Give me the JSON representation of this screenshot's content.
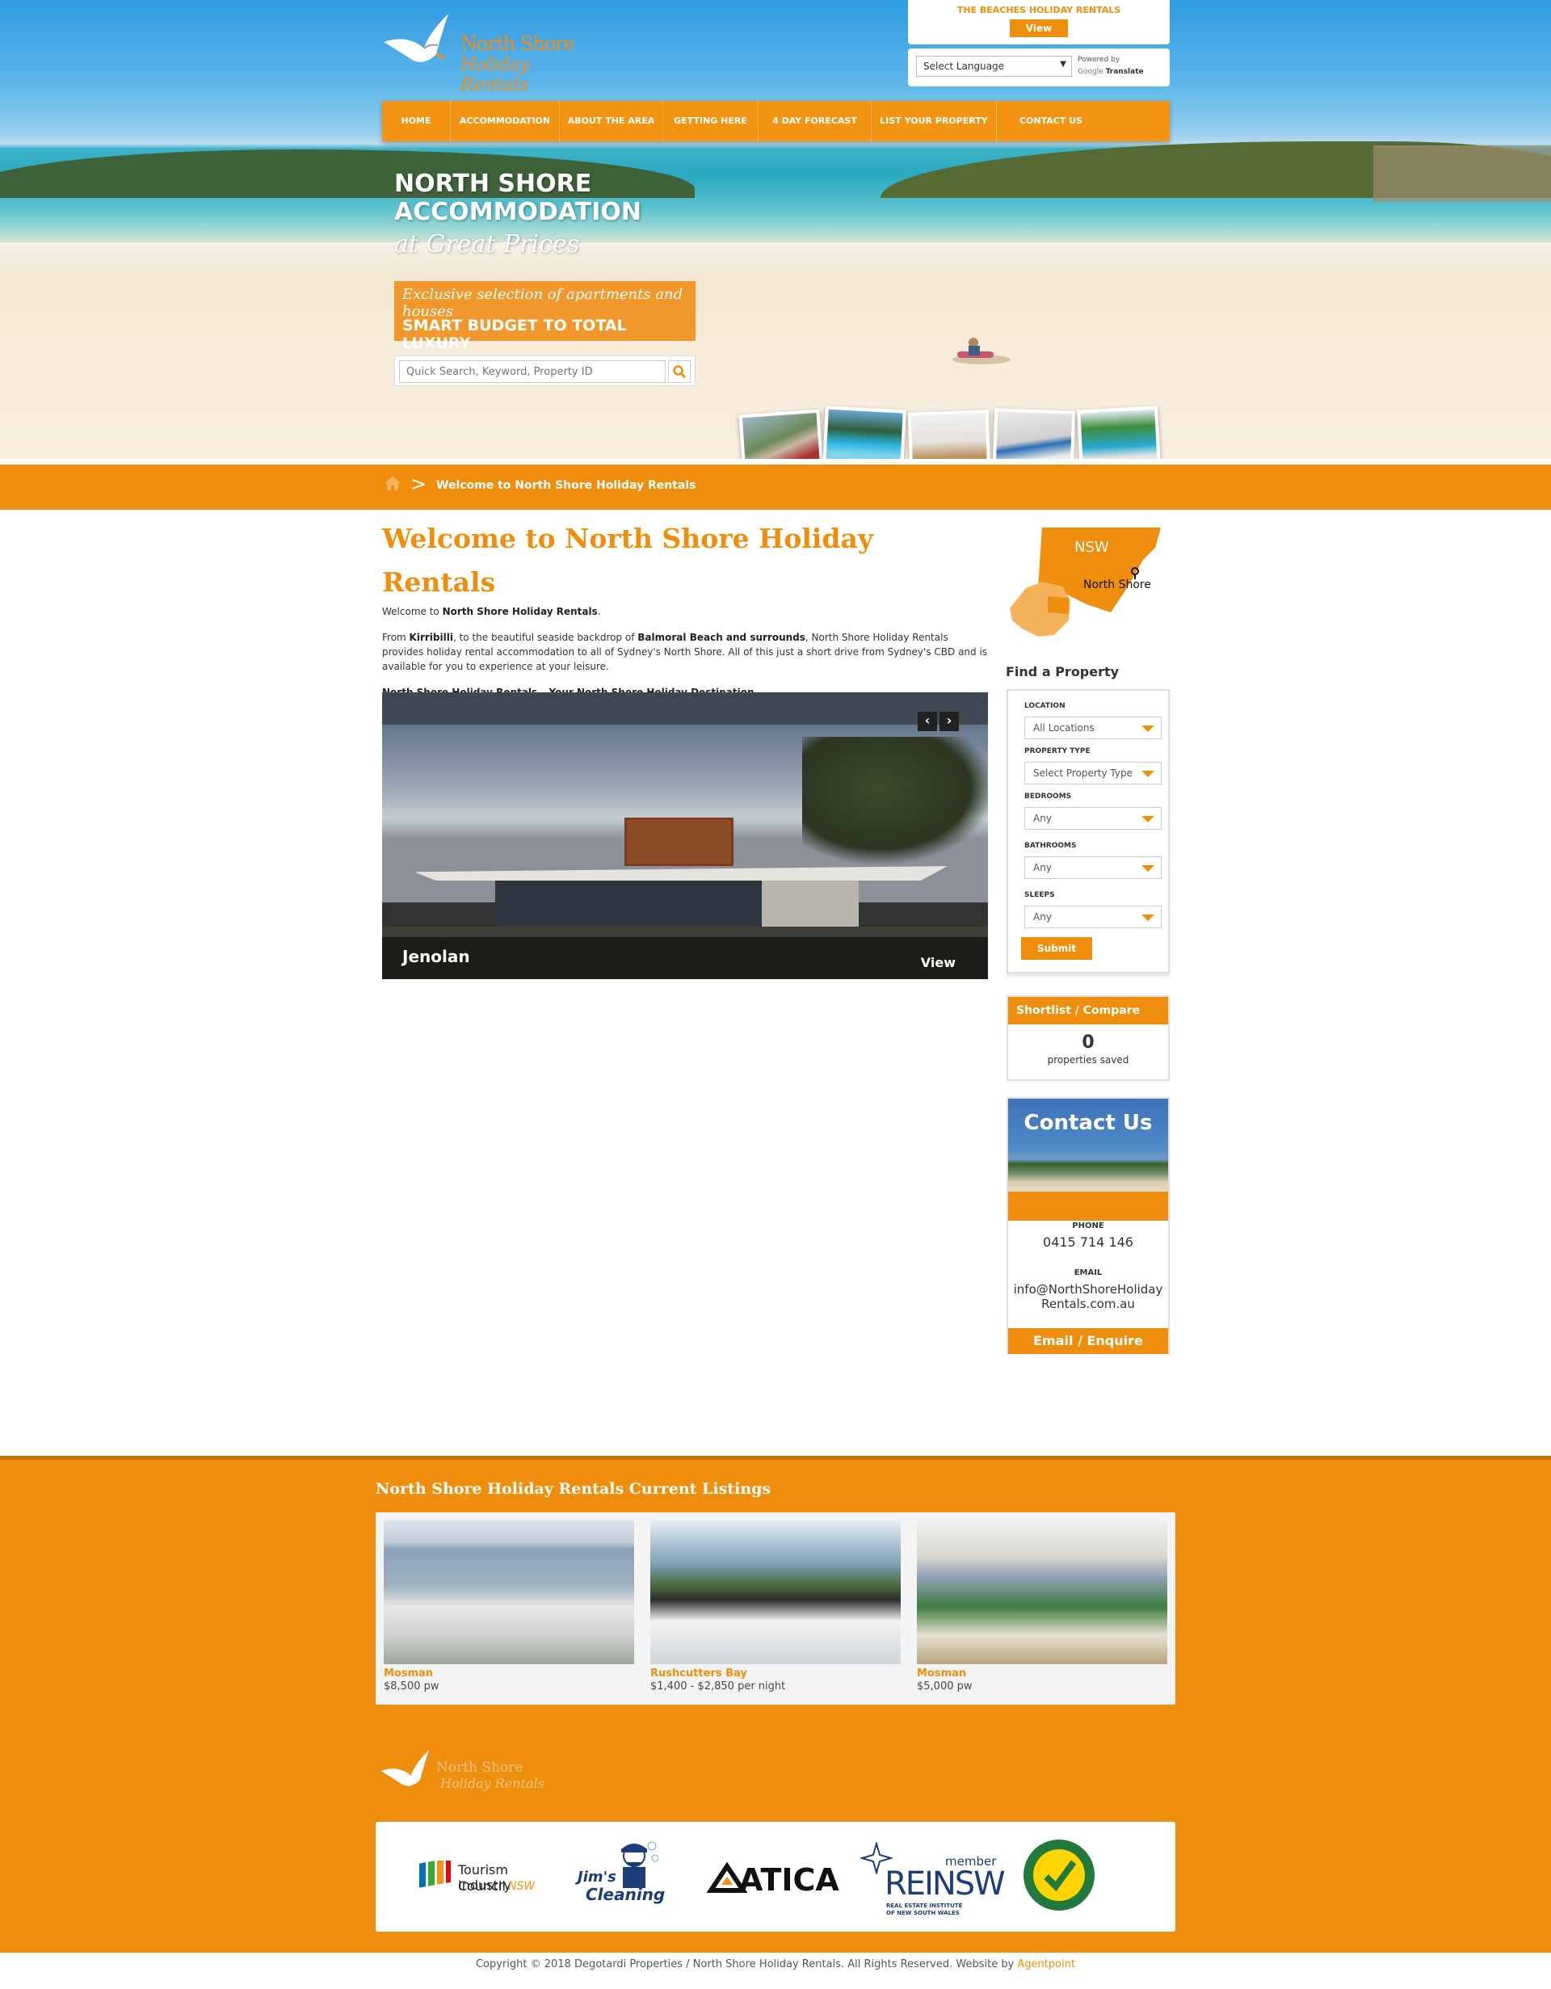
{
  "header": {
    "logo_line1": "North Shore",
    "logo_line2": "Holiday Rentals",
    "beaches_title": "THE BEACHES HOLIDAY RENTALS",
    "beaches_view": "View",
    "language_select": "Select Language",
    "powered_by": "Powered by",
    "google": "Google",
    "translate": "Translate"
  },
  "nav": [
    {
      "label": "HOME"
    },
    {
      "label": "ACCOMMODATION"
    },
    {
      "label": "ABOUT THE AREA"
    },
    {
      "label": "GETTING HERE"
    },
    {
      "label": "4 DAY FORECAST"
    },
    {
      "label": "LIST YOUR PROPERTY"
    },
    {
      "label": "CONTACT US"
    }
  ],
  "hero": {
    "line1": "NORTH SHORE",
    "line2": "ACCOMMODATION",
    "line3": "at Great Prices",
    "promo_script": "Exclusive selection of apartments and houses",
    "promo_bold": "SMART BUDGET TO TOTAL LUXURY",
    "search_placeholder": "Quick Search, Keyword, Property ID"
  },
  "breadcrumb": {
    "current": "Welcome to North Shore Holiday Rentals"
  },
  "main": {
    "title": "Welcome to North Shore Holiday Rentals",
    "intro_prefix": "Welcome to ",
    "intro_bold": "North Shore Holiday Rentals",
    "intro_suffix": ".",
    "p2_a": "From ",
    "p2_kirribilli": "Kirribilli",
    "p2_b": ", to the beautiful seaside backdrop of ",
    "p2_balmoral": "Balmoral Beach and surrounds",
    "p2_c": ", North Shore Holiday Rentals provides holiday rental accommodation to all of Sydney's North Shore. All of this just a short drive from Sydney's CBD and is available for you to experience at your leisure.",
    "tagline": "North Shore Holiday Rentals – Your North Shore Holiday Destination",
    "slider_caption": "Jenolan",
    "slider_view": "View"
  },
  "map": {
    "state": "NSW",
    "region": "North Shore"
  },
  "find": {
    "title": "Find a Property",
    "fields": [
      {
        "label": "LOCATION",
        "value": "All Locations"
      },
      {
        "label": "PROPERTY TYPE",
        "value": "Select Property Type"
      },
      {
        "label": "BEDROOMS",
        "value": "Any"
      },
      {
        "label": "BATHROOMS",
        "value": "Any"
      },
      {
        "label": "SLEEPS",
        "value": "Any"
      }
    ],
    "submit": "Submit"
  },
  "shortlist": {
    "title": "Shortlist / Compare",
    "count": "0",
    "label": "properties saved"
  },
  "contact": {
    "title": "Contact Us",
    "phone_label": "PHONE",
    "phone": "0415 714 146",
    "email_label": "EMAIL",
    "email_line1": "info@NorthShoreHoliday",
    "email_line2": "Rentals.com.au",
    "button": "Email / Enquire"
  },
  "footer": {
    "listings_title": "North Shore Holiday Rentals Current Listings",
    "listings": [
      {
        "suburb": "Mosman",
        "price": "$8,500 pw"
      },
      {
        "suburb": "Rushcutters Bay",
        "price": "$1,400 - $2,850 per night"
      },
      {
        "suburb": "Mosman",
        "price": "$5,000 pw"
      }
    ],
    "partners": {
      "tic_line1": "Tourism Industry",
      "tic_line2": "Council",
      "tic_nsw": "NSW",
      "jims": "Jim's",
      "cleaning": "Cleaning",
      "atica": "ATICA",
      "rei_member": "member",
      "rei": "REINSW",
      "rei_sub1": "REAL ESTATE INSTITUTE",
      "rei_sub2": "OF NEW SOUTH WALES"
    },
    "copyright": "Copyright © 2018 Degotardi Properties / North Shore Holiday Rentals. All Rights Reserved. Website by ",
    "agent": "Agentpoint"
  },
  "colors": {
    "accent": "#ef8e0c",
    "nav": "#f29412"
  }
}
